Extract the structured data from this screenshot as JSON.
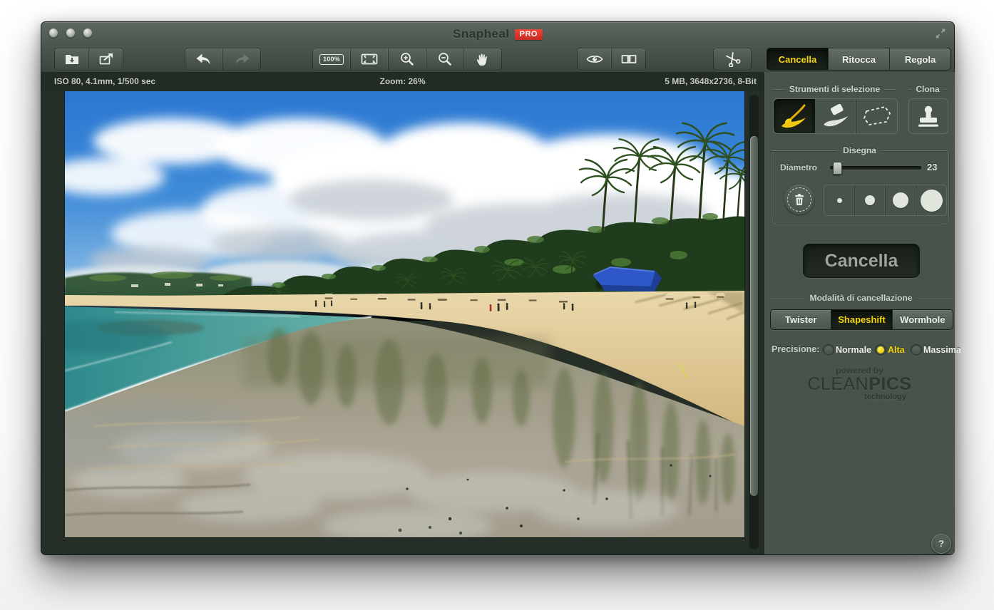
{
  "window": {
    "title": "Snapheal",
    "badge": "PRO",
    "traffic_lights": [
      "close",
      "minimize",
      "zoom"
    ]
  },
  "toolbar": {
    "zoom_100_label": "100%",
    "icons": [
      "import-folder",
      "export",
      "undo",
      "redo",
      "zoom-100",
      "fit-screen",
      "zoom-in",
      "zoom-out",
      "hand",
      "preview-eye",
      "split-view",
      "crop-scissors"
    ],
    "redo_disabled": true
  },
  "tabs": {
    "items": [
      {
        "label": "Cancella",
        "active": true
      },
      {
        "label": "Ritocca",
        "active": false
      },
      {
        "label": "Regola",
        "active": false
      }
    ]
  },
  "infobar": {
    "left": "ISO 80, 4.1mm, 1/500 sec",
    "center": "Zoom: 26%",
    "right": "5 MB, 3648x2736, 8-Bit"
  },
  "panel": {
    "selection": {
      "legend": "Strumenti di selezione",
      "tools": [
        "brush",
        "eraser",
        "lasso"
      ],
      "active_tool": "brush"
    },
    "clone": {
      "legend": "Clona",
      "tool": "stamp"
    },
    "draw": {
      "legend": "Disegna",
      "diameter_label": "Diametro",
      "diameter_value": "23",
      "brush_sizes": 4
    },
    "erase_action": {
      "label": "Cancella"
    },
    "mode": {
      "legend": "Modalità di cancellazione",
      "options": [
        "Twister",
        "Shapeshift",
        "Wormhole"
      ],
      "active": "Shapeshift"
    },
    "precision": {
      "label": "Precisione:",
      "options": [
        "Normale",
        "Alta",
        "Massima"
      ],
      "active": "Alta"
    },
    "branding": {
      "powered_by": "powered by",
      "brand_a": "CLEAN",
      "brand_b": "PICS",
      "tagline": "technology"
    },
    "help": "?"
  },
  "colors": {
    "accent_yellow": "#f7d60e",
    "pro_badge_red": "#d93529",
    "panel_bg": "#47534b",
    "canvas_bg": "#262e28",
    "infobar_bg": "#232b25"
  }
}
